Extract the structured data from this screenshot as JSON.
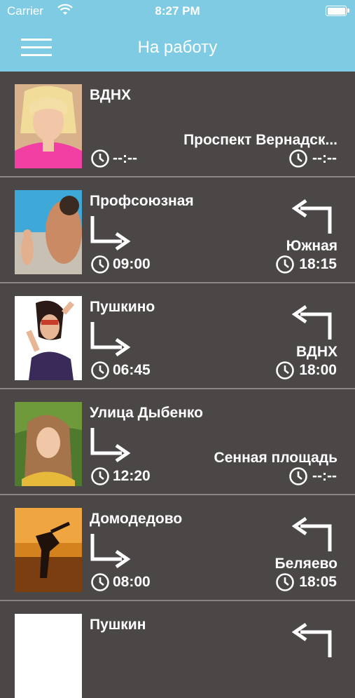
{
  "status_bar": {
    "carrier": "Carrier",
    "time": "8:27 PM"
  },
  "nav": {
    "title": "На работу"
  },
  "rows": [
    {
      "from": "ВДНХ",
      "to": "Проспект Вернадск...",
      "depart_time": "--:--",
      "return_time": "--:--",
      "show_arrows": false,
      "avatar": "avatar-blonde-pink"
    },
    {
      "from": "Профсоюзная",
      "to": "Южная",
      "depart_time": "09:00",
      "return_time": "18:15",
      "show_arrows": true,
      "avatar": "avatar-beach"
    },
    {
      "from": "Пушкино",
      "to": "ВДНХ",
      "depart_time": "06:45",
      "return_time": "18:00",
      "show_arrows": true,
      "avatar": "avatar-comic"
    },
    {
      "from": "Улица Дыбенко",
      "to": "Сенная площадь",
      "depart_time": "12:20",
      "return_time": "--:--",
      "show_arrows": true,
      "avatar": "avatar-grass"
    },
    {
      "from": "Домодедово",
      "to": "Беляево",
      "depart_time": "08:00",
      "return_time": "18:05",
      "show_arrows": true,
      "avatar": "avatar-sunset"
    },
    {
      "from": "Пушкин",
      "avatar": "avatar-partial"
    }
  ],
  "colors": {
    "header": "#7ecbe3",
    "list_bg": "#4a4746",
    "divider": "#8a8685",
    "text": "#ffffff"
  }
}
